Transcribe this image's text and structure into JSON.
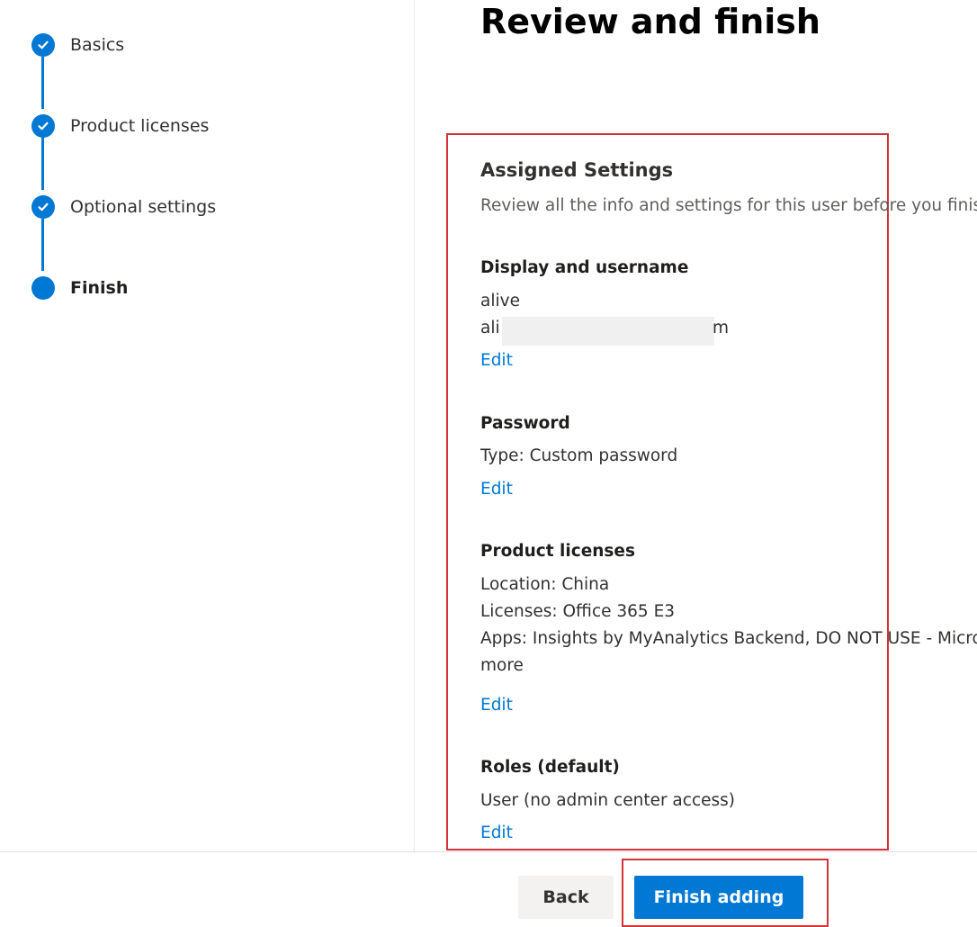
{
  "steps": [
    {
      "label": "Basics",
      "status": "completed"
    },
    {
      "label": "Product licenses",
      "status": "completed"
    },
    {
      "label": "Optional settings",
      "status": "completed"
    },
    {
      "label": "Finish",
      "status": "current"
    }
  ],
  "page": {
    "title": "Review and finish"
  },
  "review": {
    "heading": "Assigned Settings",
    "subtitle": "Review all the info and settings for this user before you finis",
    "display": {
      "heading": "Display and username",
      "display_name": "alive",
      "username_prefix": "ali",
      "username_suffix": "m",
      "edit_label": "Edit"
    },
    "password": {
      "heading": "Password",
      "type": "Type: Custom password",
      "edit_label": "Edit"
    },
    "licenses": {
      "heading": "Product licenses",
      "location": "Location: China",
      "licenses": "Licenses: Office 365 E3",
      "apps": "Apps: Insights by MyAnalytics Backend, DO NOT USE - Micro",
      "more": "more",
      "edit_label": "Edit"
    },
    "roles": {
      "heading": "Roles (default)",
      "value": "User (no admin center access)",
      "edit_label": "Edit"
    }
  },
  "footer": {
    "back_label": "Back",
    "finish_label": "Finish adding"
  },
  "colors": {
    "accent": "#0078d4",
    "highlight": "#d13438"
  },
  "icons": {
    "completed_step": "checkmark-icon",
    "current_step": "filled-circle-icon"
  }
}
